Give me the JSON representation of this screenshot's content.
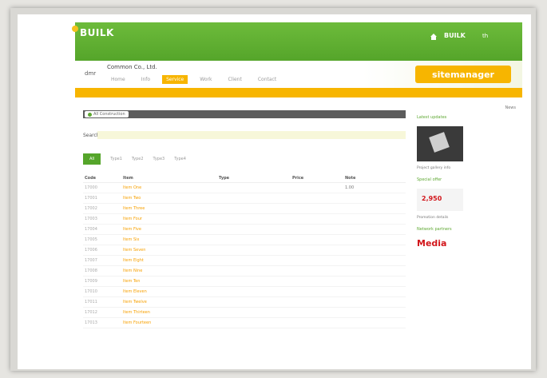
{
  "colors": {
    "green": "#5ea832",
    "orange": "#f7b500",
    "dark": "#5c5c5c",
    "accent_text": "#f7a000"
  },
  "topbar": {
    "logo": "BUILK",
    "brand": "BUILK",
    "lang": "th"
  },
  "header": {
    "company": "Common Co., Ltd.",
    "logo_text": "dmr",
    "nav": [
      "Home",
      "Info",
      "Service",
      "Work",
      "Client",
      "Contact"
    ],
    "active_nav": 2,
    "sitemanager": "sitemanager"
  },
  "section": {
    "title": "All Construction"
  },
  "search": {
    "label": "Search"
  },
  "filters": [
    "All",
    "Type1",
    "Type2",
    "Type3",
    "Type4"
  ],
  "table": {
    "headers": [
      "Code",
      "Item",
      "Type",
      "Price",
      "Note"
    ],
    "rows": [
      [
        "17000",
        "Item One",
        "",
        " ",
        "1.00",
        ""
      ],
      [
        "17001",
        "Item Two",
        "",
        "",
        ""
      ],
      [
        "17002",
        "Item Three",
        "",
        "",
        ""
      ],
      [
        "17003",
        "Item Four",
        "",
        "",
        ""
      ],
      [
        "17004",
        "Item Five",
        "",
        "",
        ""
      ],
      [
        "17005",
        "Item Six",
        "",
        "",
        ""
      ],
      [
        "17006",
        "Item Seven",
        "",
        "",
        ""
      ],
      [
        "17007",
        "Item Eight",
        "",
        "",
        ""
      ],
      [
        "17008",
        "Item Nine",
        "",
        "",
        ""
      ],
      [
        "17009",
        "Item Ten",
        "",
        "",
        ""
      ],
      [
        "17010",
        "Item Eleven",
        "",
        "",
        ""
      ],
      [
        "17011",
        "Item Twelve",
        "",
        "",
        ""
      ],
      [
        "17012",
        "Item Thirteen",
        "",
        "",
        ""
      ],
      [
        "17013",
        "Item Fourteen",
        "",
        "",
        ""
      ]
    ]
  },
  "sidebar": {
    "title": "News",
    "link1": "Latest updates",
    "text1": "Project gallery info",
    "link2": "Special offer",
    "price": "2,950",
    "text2": "Promotion details",
    "link3": "Network partners",
    "media": "Media"
  }
}
